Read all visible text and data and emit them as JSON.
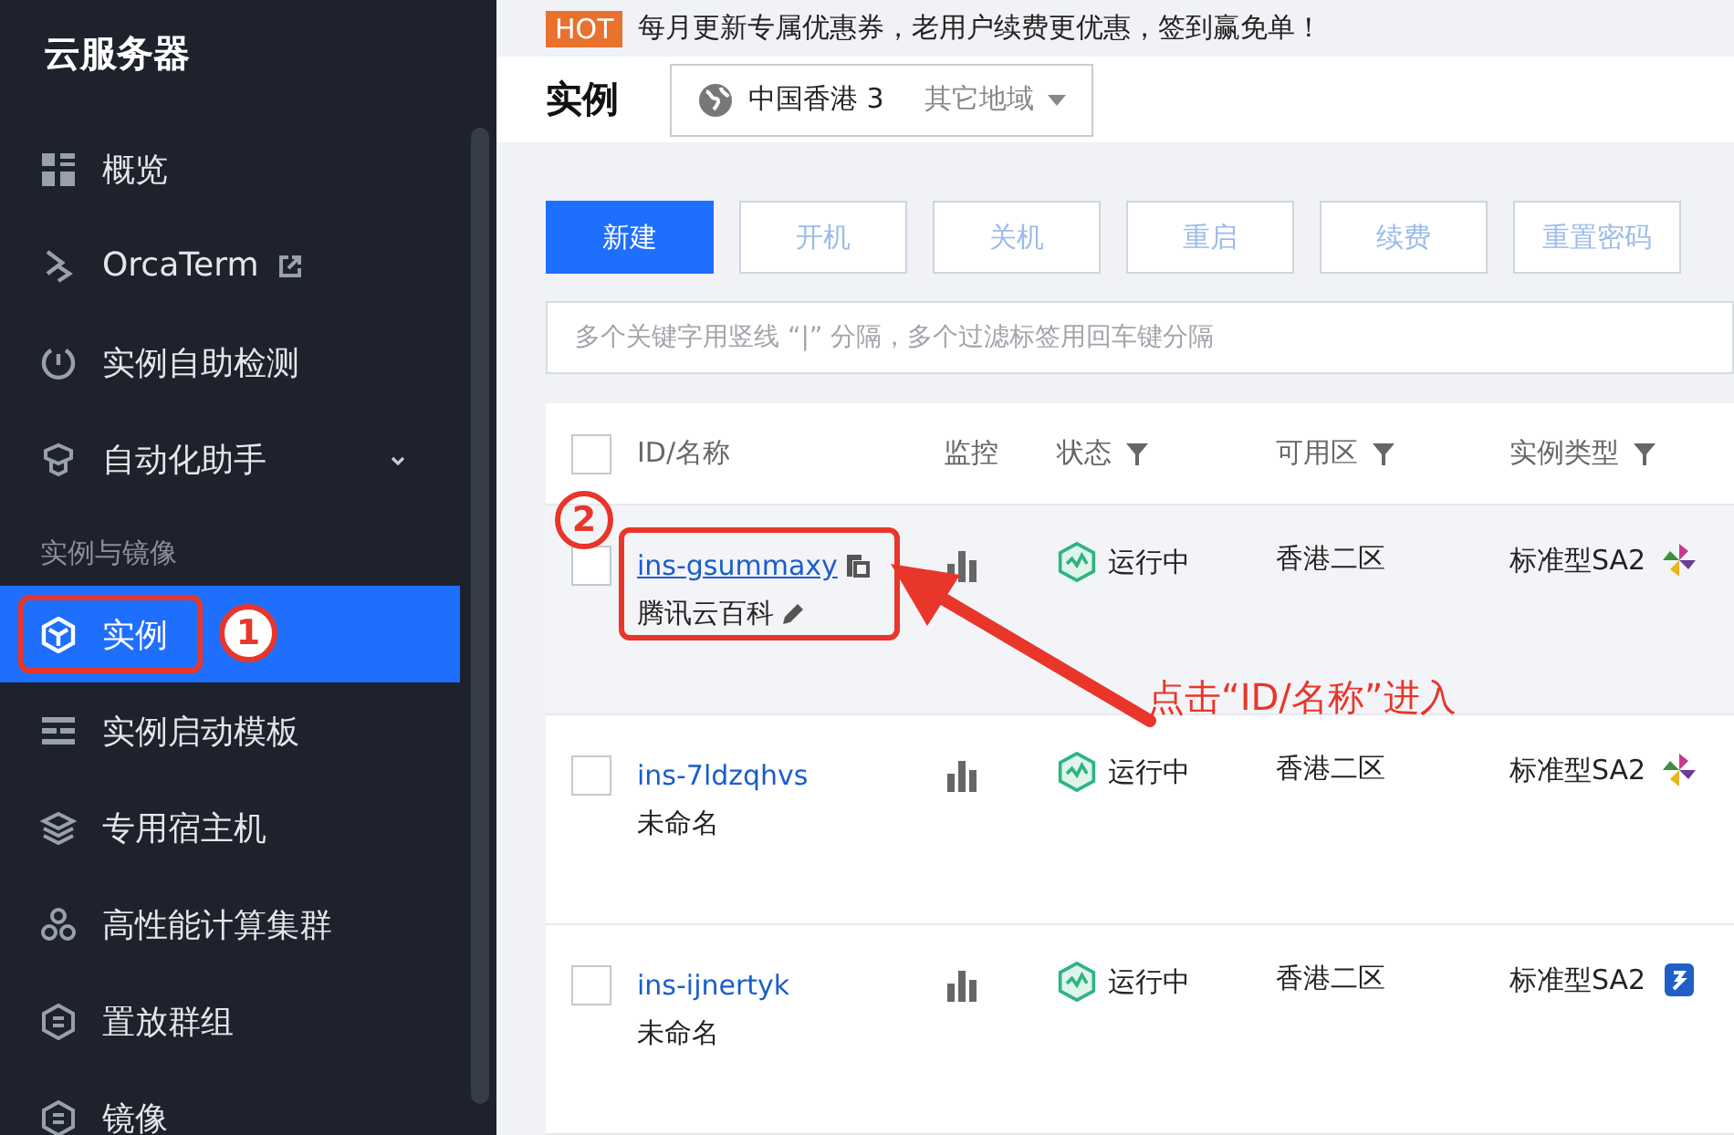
{
  "sidebar": {
    "title": "云服务器",
    "items": [
      {
        "kind": "link",
        "label": "概览",
        "selected": false
      },
      {
        "kind": "link",
        "label": "OrcaTerm",
        "selected": false,
        "external": true
      },
      {
        "kind": "link",
        "label": "实例自助检测",
        "selected": false
      },
      {
        "kind": "link",
        "label": "自动化助手",
        "selected": false,
        "expanded": false
      },
      {
        "kind": "section",
        "label": "实例与镜像"
      },
      {
        "kind": "link",
        "label": "实例",
        "selected": true
      },
      {
        "kind": "link",
        "label": "实例启动模板",
        "selected": false
      },
      {
        "kind": "link",
        "label": "专用宿主机",
        "selected": false
      },
      {
        "kind": "link",
        "label": "高性能计算集群",
        "selected": false
      },
      {
        "kind": "link",
        "label": "置放群组",
        "selected": false
      },
      {
        "kind": "link",
        "label": "镜像",
        "selected": false
      }
    ]
  },
  "banner": {
    "badge": "HOT",
    "text": "每月更新专属优惠券，老用户续费更优惠，签到赢免单！"
  },
  "header": {
    "title": "实例",
    "region": "中国香港 3",
    "other_regions": "其它地域"
  },
  "toolbar": {
    "buttons": [
      {
        "label": "新建",
        "disabled": false
      },
      {
        "label": "开机",
        "disabled": true
      },
      {
        "label": "关机",
        "disabled": true
      },
      {
        "label": "重启",
        "disabled": true
      },
      {
        "label": "续费",
        "disabled": true
      },
      {
        "label": "重置密码",
        "disabled": true
      }
    ],
    "search": {
      "placeholder": "多个关键字用竖线 “|” 分隔，多个过滤标签用回车键分隔"
    }
  },
  "table": {
    "select_all_checked": false,
    "columns": [
      {
        "label": "ID/名称",
        "filter": false
      },
      {
        "label": "监控",
        "filter": false
      },
      {
        "label": "状态",
        "filter": true
      },
      {
        "label": "可用区",
        "filter": true
      },
      {
        "label": "实例类型",
        "filter": true
      }
    ],
    "rows": [
      {
        "id": "ins-gsummaxy",
        "name": "腾讯云百科",
        "checked": false,
        "highlighted": true,
        "status": "运行中",
        "zone": "香港二区",
        "type": "标准型SA2"
      },
      {
        "id": "ins-7ldzqhvs",
        "name": "未命名",
        "checked": false,
        "highlighted": false,
        "status": "运行中",
        "zone": "香港二区",
        "type": "标准型SA2"
      },
      {
        "id": "ins-ijnertyk",
        "name": "未命名",
        "checked": false,
        "highlighted": false,
        "status": "运行中",
        "zone": "香港二区",
        "type": "标准型SA2"
      }
    ]
  },
  "annotations": {
    "step_one": "1",
    "step_two": "2",
    "callout": "点击“ID/名称”进入"
  }
}
